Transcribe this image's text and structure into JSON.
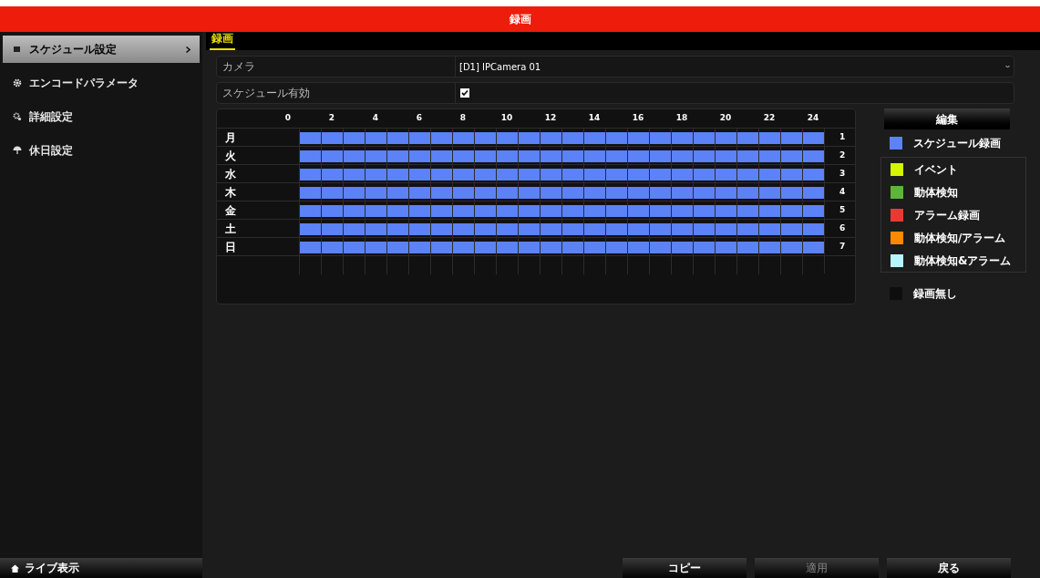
{
  "window": {
    "title": "録画"
  },
  "sidebar": {
    "items": [
      {
        "label": "スケジュール設定",
        "selected": true
      },
      {
        "label": "エンコードパラメータ",
        "selected": false
      },
      {
        "label": "詳細設定",
        "selected": false
      },
      {
        "label": "休日設定",
        "selected": false
      }
    ],
    "footer": {
      "label": "ライブ表示"
    }
  },
  "tabs": [
    {
      "label": "録画",
      "selected": true
    }
  ],
  "camera": {
    "label": "カメラ",
    "value": "[D1] IPCamera 01"
  },
  "schedule_enabled": {
    "label": "スケジュール有効",
    "checked": true
  },
  "schedule": {
    "hours": [
      "0",
      "2",
      "4",
      "6",
      "8",
      "10",
      "12",
      "14",
      "16",
      "18",
      "20",
      "22",
      "24"
    ],
    "days": [
      {
        "label": "月",
        "number": "1"
      },
      {
        "label": "火",
        "number": "2"
      },
      {
        "label": "水",
        "number": "3"
      },
      {
        "label": "木",
        "number": "4"
      },
      {
        "label": "金",
        "number": "5"
      },
      {
        "label": "土",
        "number": "6"
      },
      {
        "label": "日",
        "number": "7"
      }
    ]
  },
  "edit_button": "編集",
  "legend": [
    {
      "kind": "schedule",
      "label": "スケジュール録画",
      "color": "#5b82f7"
    },
    {
      "kind": "event",
      "label": "イベント",
      "color": "#d4f500"
    },
    {
      "kind": "motion",
      "label": "動体検知",
      "color": "#5fb43a"
    },
    {
      "kind": "alarm",
      "label": "アラーム録画",
      "color": "#e83a33"
    },
    {
      "kind": "motion_or_alarm",
      "label": "動体検知/アラーム",
      "color": "#ff8a00"
    },
    {
      "kind": "motion_and_alarm",
      "label": "動体検知&アラーム",
      "color": "#b8f4ff"
    },
    {
      "kind": "none",
      "label": "録画無し",
      "color": "#0e0e0e"
    }
  ],
  "buttons": [
    {
      "label": "コピー",
      "disabled": false
    },
    {
      "label": "適用",
      "disabled": true
    },
    {
      "label": "戻る",
      "disabled": false
    }
  ]
}
